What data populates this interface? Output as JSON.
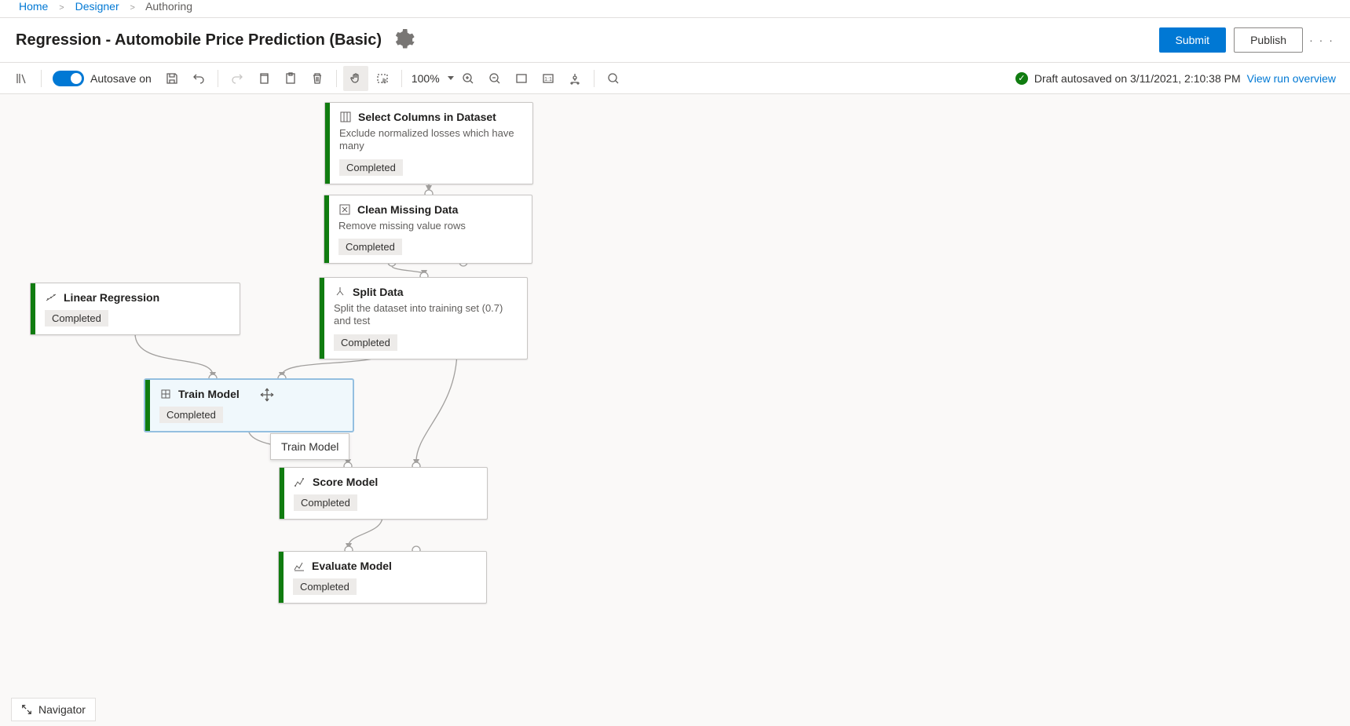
{
  "breadcrumb": {
    "home": "Home",
    "designer": "Designer",
    "current": "Authoring"
  },
  "header": {
    "title": "Regression - Automobile Price Prediction (Basic)",
    "submit": "Submit",
    "publish": "Publish"
  },
  "toolbar": {
    "autosave_label": "Autosave on",
    "zoom": "100%"
  },
  "status": {
    "text": "Draft autosaved on 3/11/2021, 2:10:38 PM",
    "link": "View run overview"
  },
  "nodes": {
    "select_columns": {
      "title": "Select Columns in Dataset",
      "desc": "Exclude normalized losses which have many",
      "status": "Completed"
    },
    "clean": {
      "title": "Clean Missing Data",
      "desc": "Remove missing value rows",
      "status": "Completed"
    },
    "split": {
      "title": "Split Data",
      "desc": "Split the dataset into training set (0.7) and test",
      "status": "Completed"
    },
    "linreg": {
      "title": "Linear Regression",
      "status": "Completed"
    },
    "train": {
      "title": "Train Model",
      "status": "Completed"
    },
    "score": {
      "title": "Score Model",
      "status": "Completed"
    },
    "evaluate": {
      "title": "Evaluate Model",
      "status": "Completed"
    }
  },
  "tooltip": "Train Model",
  "navigator": "Navigator"
}
